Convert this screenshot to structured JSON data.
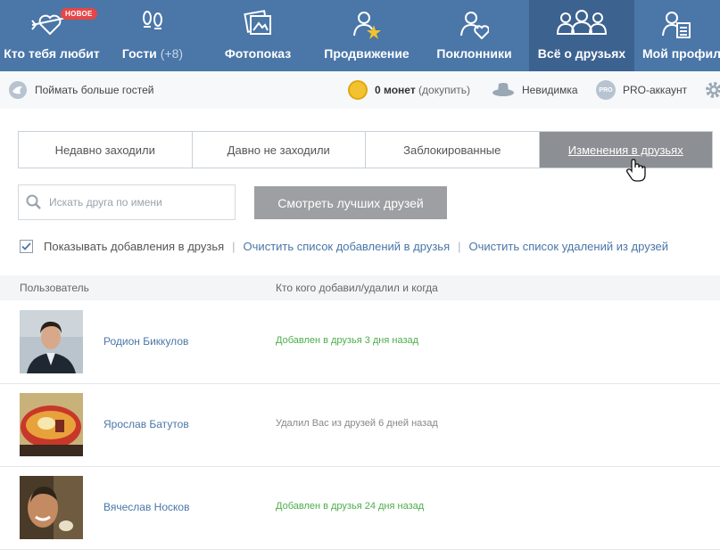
{
  "nav": {
    "items": [
      {
        "label": "Кто тебя любит",
        "icon": "heart-arrow-icon",
        "badge": "НОВОЕ"
      },
      {
        "label": "Гости",
        "count": "(+8)",
        "icon": "footprints-icon"
      },
      {
        "label": "Фотопоказ",
        "icon": "photos-icon"
      },
      {
        "label": "Продвижение",
        "icon": "user-star-icon"
      },
      {
        "label": "Поклонники",
        "icon": "user-heart-icon"
      },
      {
        "label": "Всё о друзьях",
        "icon": "friends-group-icon"
      },
      {
        "label": "Мой профиль",
        "icon": "user-profile-icon"
      }
    ]
  },
  "subbar": {
    "more_guests": "Поймать больше гостей",
    "coins": "0 монет",
    "buy": "(докупить)",
    "invisible": "Невидимка",
    "pro": "PRO-аккаунт",
    "pro_icon_text": "PRO"
  },
  "tabs": [
    "Недавно заходили",
    "Давно не заходили",
    "Заблокированные",
    "Изменения в друзьях"
  ],
  "search": {
    "placeholder": "Искать друга по имени"
  },
  "best_button": "Смотреть лучших друзей",
  "options": {
    "show_additions": "Показывать добавления в друзья",
    "checked": true,
    "separator": "|",
    "clear_additions": "Очистить список добавлений в друзья",
    "clear_removals": "Очистить список удалений из друзей"
  },
  "table": {
    "headers": [
      "Пользователь",
      "Кто кого добавил/удалил и когда"
    ],
    "rows": [
      {
        "name": "Родион Биккулов",
        "status": "Добавлен в друзья 3 дня назад",
        "type": "added"
      },
      {
        "name": "Ярослав Батутов",
        "status": "Удалил Вас из друзей 6 дней назад",
        "type": "removed"
      },
      {
        "name": "Вячеслав Носков",
        "status": "Добавлен в друзья 24 дня назад",
        "type": "added"
      }
    ]
  },
  "colors": {
    "nav_bg": "#4a76a8",
    "nav_active": "#3c6290",
    "link": "#4a76a8",
    "added": "#4cae4c",
    "removed": "#888888",
    "active_tab": "#8c8f93",
    "badge": "#e64646"
  }
}
